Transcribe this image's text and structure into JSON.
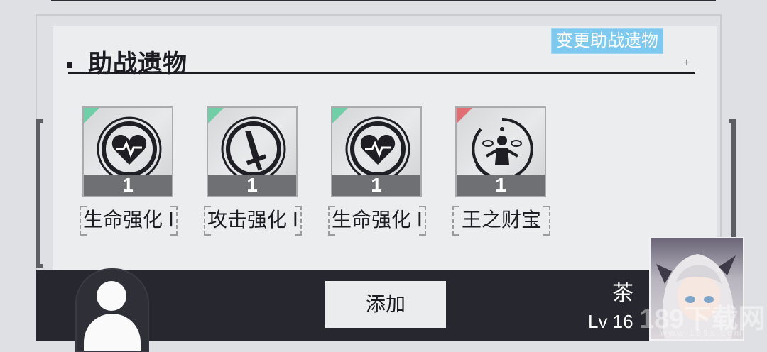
{
  "section": {
    "title": "助战遗物",
    "change_button": "变更助战遗物"
  },
  "relics": [
    {
      "name": "生命强化 Ⅰ",
      "count": "1",
      "icon": "heart-pulse-icon",
      "rarity_color": "#6fd0a8"
    },
    {
      "name": "攻击强化 Ⅰ",
      "count": "1",
      "icon": "sword-icon",
      "rarity_color": "#6fd0a8"
    },
    {
      "name": "生命强化 Ⅰ",
      "count": "1",
      "icon": "heart-pulse-icon",
      "rarity_color": "#6fd0a8"
    },
    {
      "name": "王之财宝",
      "count": "1",
      "icon": "juggling-figure-icon",
      "rarity_color": "#e06e72"
    }
  ],
  "bottom": {
    "add_button": "添加",
    "character_name": "茶",
    "character_level": "Lv 16"
  },
  "watermark": {
    "text": "189下载网",
    "sub": "www.189x.com"
  }
}
